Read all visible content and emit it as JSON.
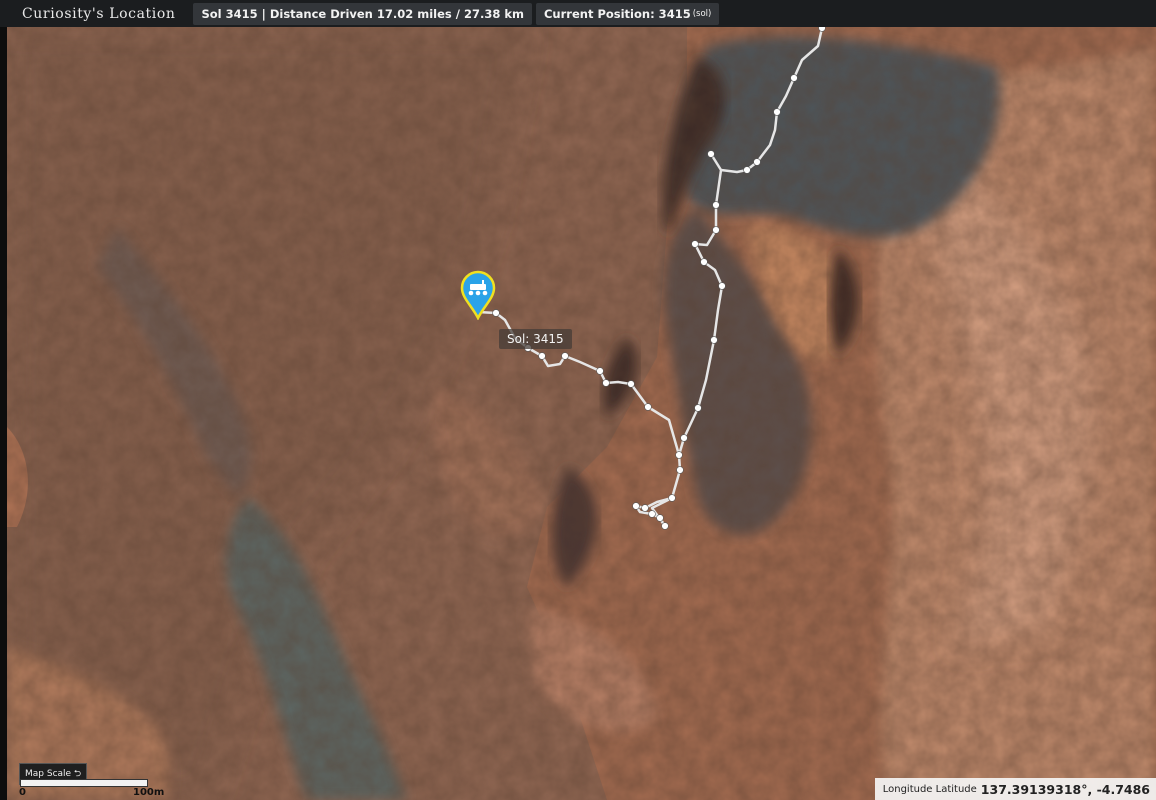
{
  "header": {
    "title": "Curiosity's Location",
    "sol_info": "Sol 3415 | Distance Driven 17.02 miles / 27.38 km",
    "position_label": "Current Position: 3415",
    "position_unit": "(sol)"
  },
  "map": {
    "sol_marker_label": "Sol: 3415",
    "pin_color": "#2aa3e8",
    "pin_outline": "#f0e020",
    "traverse_color": "#e6e6e6",
    "pin_icon": "rover-icon"
  },
  "scale": {
    "button_label": "Map Scale ⮌",
    "start": "0",
    "end": "100m"
  },
  "coordinates": {
    "label": "Longitude Latitude",
    "value": "137.39139318°, -4.7486"
  }
}
